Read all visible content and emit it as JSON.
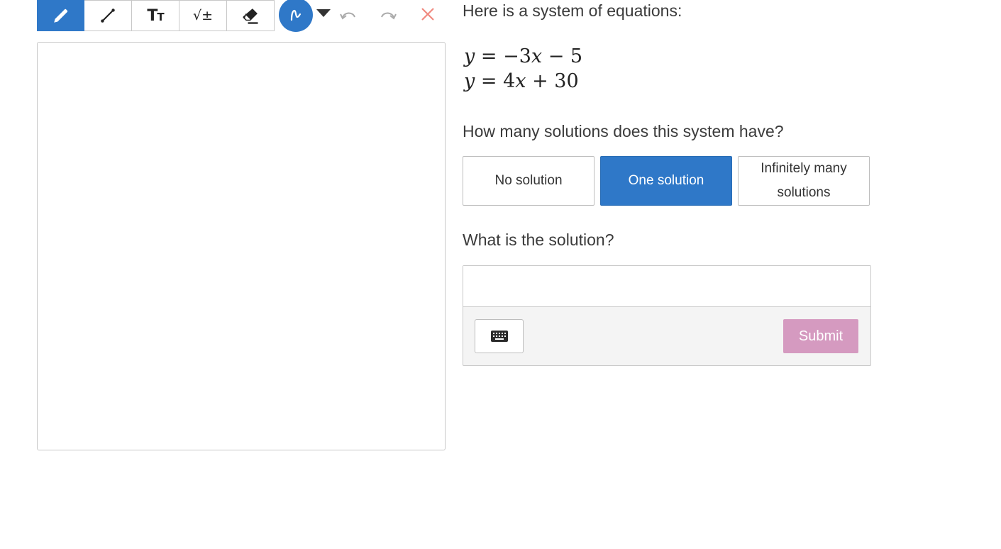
{
  "toolbar": {
    "tools": [
      {
        "icon": "pencil-icon",
        "active": true
      },
      {
        "icon": "line-icon",
        "active": false
      },
      {
        "icon": "text-icon",
        "label": "Tт",
        "active": false
      },
      {
        "icon": "math-icon",
        "label": "√±",
        "active": false
      },
      {
        "icon": "eraser-icon",
        "active": false
      }
    ],
    "color": "#2f78c8",
    "undo_icon": "undo-icon",
    "redo_icon": "redo-icon",
    "clear_icon": "close-icon",
    "clear_color": "#f08a80"
  },
  "question": {
    "intro": "Here is a system of equations:",
    "equations": [
      {
        "lhs": "y",
        "rel": "=",
        "rhs_pre": "−3",
        "var": "x",
        "rhs_post": "− 5"
      },
      {
        "lhs": "y",
        "rel": "=",
        "rhs_pre": "4",
        "var": "x",
        "rhs_post": "+ 30"
      }
    ],
    "count_prompt": "How many solutions does this system have?",
    "choices": [
      {
        "label": "No solution",
        "selected": false
      },
      {
        "label": "One solution",
        "selected": true
      },
      {
        "label": "Infinitely many solutions",
        "selected": false
      }
    ],
    "solution_prompt": "What is the solution?",
    "answer_value": "",
    "keyboard_icon": "keyboard-icon",
    "submit_label": "Submit"
  },
  "colors": {
    "primary": "#2f78c8",
    "submit_disabled": "#d59ac0"
  }
}
